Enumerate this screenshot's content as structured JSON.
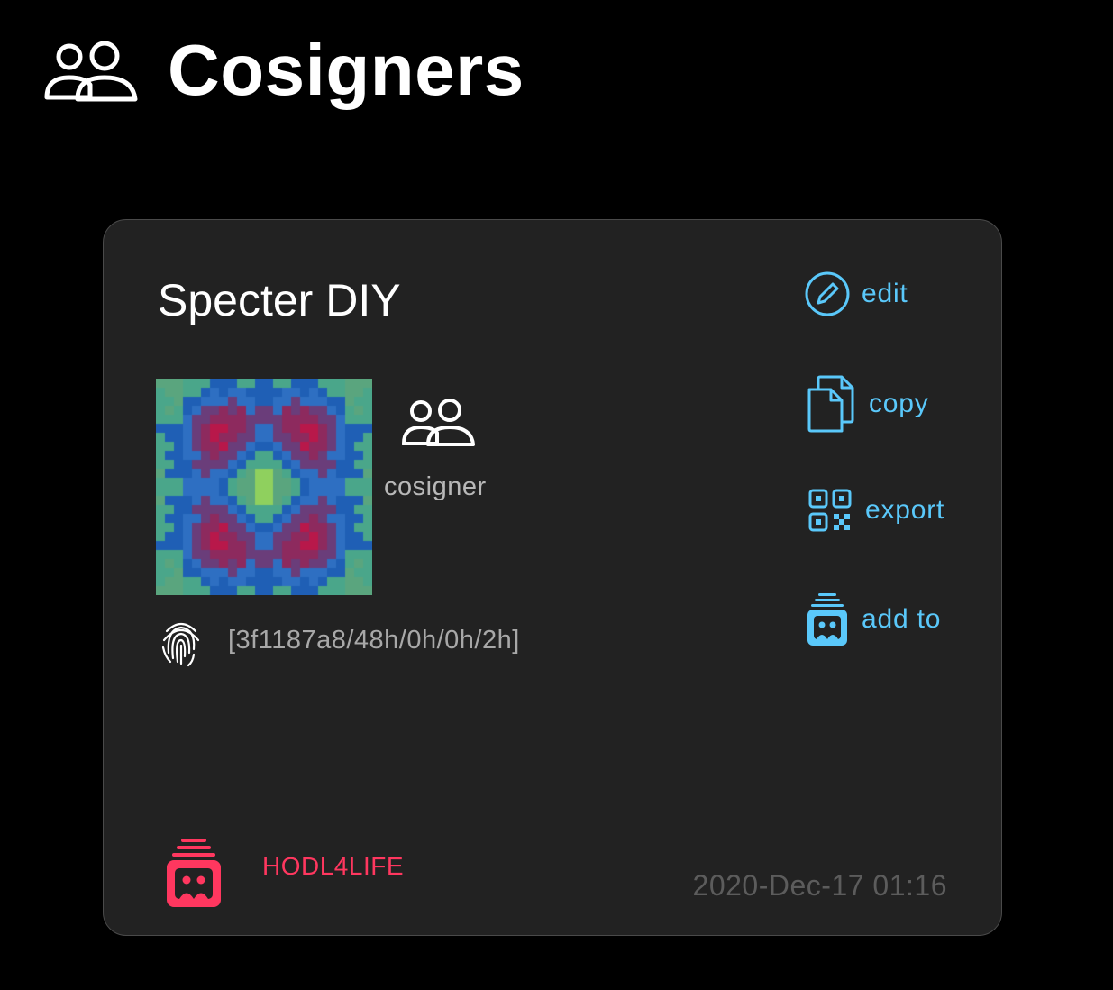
{
  "page": {
    "title": "Cosigners",
    "icon": "people-icon"
  },
  "card": {
    "name": "Specter DIY",
    "role_label": "cosigner",
    "fingerprint": "[3f1187a8/48h/0h/0h/2h]",
    "actions": [
      {
        "label": "edit",
        "icon": "pencil-circle-icon"
      },
      {
        "label": "copy",
        "icon": "copy-documents-icon"
      },
      {
        "label": "export",
        "icon": "qr-code-icon"
      },
      {
        "label": "add to",
        "icon": "vault-icon"
      }
    ],
    "wallet": {
      "name": "HODL4LIFE",
      "icon": "vault-icon"
    },
    "timestamp": "2020-Dec-17 01:16"
  },
  "colors": {
    "background": "#000000",
    "card": "#222222",
    "accent": "#5ac8fa",
    "wallet": "#ff375f",
    "muted": "#5c5c5c",
    "identicon": [
      "#b8184a",
      "#8d2a5e",
      "#6a3d7a",
      "#2e6fc2",
      "#1f5fb5",
      "#4aa68a",
      "#5aa57e",
      "#8fd05e"
    ]
  }
}
